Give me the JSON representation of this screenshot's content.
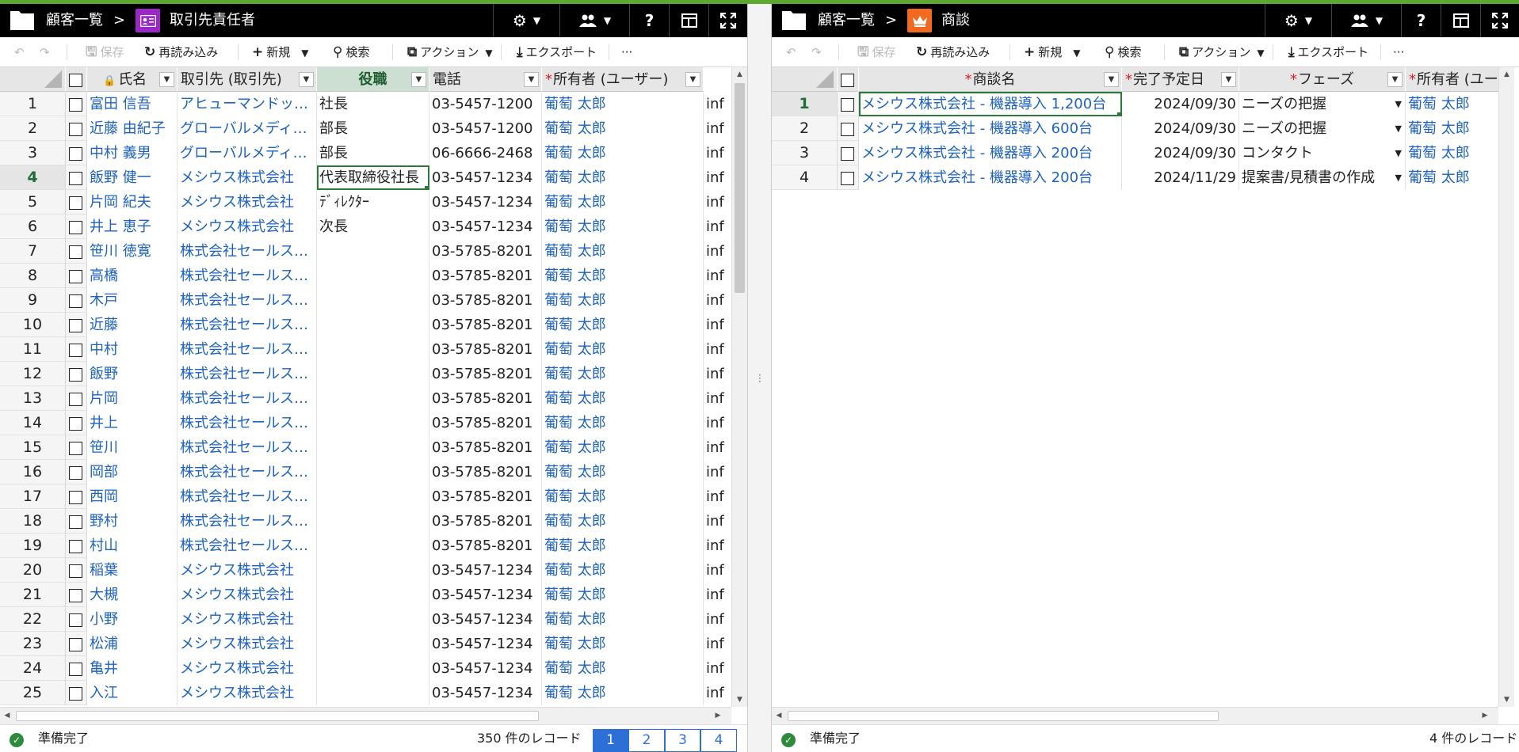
{
  "left": {
    "header": {
      "breadcrumb_root": "顧客一覧",
      "separator": ">",
      "title": "取引先責任者",
      "object_color": "#9b27c7"
    },
    "toolbar": {
      "save": "保存",
      "reload": "再読み込み",
      "new": "新規",
      "search": "検索",
      "action": "アクション",
      "export": "エクスポート",
      "more": "···"
    },
    "columns": [
      "氏名",
      "取引先 (取引先)",
      "役職",
      "電話",
      "所有者 (ユーザー)"
    ],
    "rows": [
      {
        "n": "1",
        "name": "富田 信吾",
        "account": "アヒューマンドットコ…",
        "title": "社長",
        "phone": "03-5457-1200",
        "owner": "葡萄 太郎",
        "extra": "inf"
      },
      {
        "n": "2",
        "name": "近藤 由紀子",
        "account": "グローバルメディアジ…",
        "title": "部長",
        "phone": "03-5457-1200",
        "owner": "葡萄 太郎",
        "extra": "inf"
      },
      {
        "n": "3",
        "name": "中村 義男",
        "account": "グローバルメディアジ…",
        "title": "部長",
        "phone": "06-6666-2468",
        "owner": "葡萄 太郎",
        "extra": "inf"
      },
      {
        "n": "4",
        "name": "飯野 健一",
        "account": "メシウス株式会社",
        "title": "代表取締役社長",
        "phone": "03-5457-1234",
        "owner": "葡萄 太郎",
        "extra": "inf"
      },
      {
        "n": "5",
        "name": "片岡 紀夫",
        "account": "メシウス株式会社",
        "title": "ﾃﾞｨﾚｸﾀｰ",
        "phone": "03-5457-1234",
        "owner": "葡萄 太郎",
        "extra": "inf"
      },
      {
        "n": "6",
        "name": "井上 恵子",
        "account": "メシウス株式会社",
        "title": "次長",
        "phone": "03-5457-1234",
        "owner": "葡萄 太郎",
        "extra": "inf"
      },
      {
        "n": "7",
        "name": "笹川 徳寛",
        "account": "株式会社セールス…",
        "title": "",
        "phone": "03-5785-8201",
        "owner": "葡萄 太郎",
        "extra": "inf"
      },
      {
        "n": "8",
        "name": "高橋",
        "account": "株式会社セールス…",
        "title": "",
        "phone": "03-5785-8201",
        "owner": "葡萄 太郎",
        "extra": "inf"
      },
      {
        "n": "9",
        "name": "木戸",
        "account": "株式会社セールス…",
        "title": "",
        "phone": "03-5785-8201",
        "owner": "葡萄 太郎",
        "extra": "inf"
      },
      {
        "n": "10",
        "name": "近藤",
        "account": "株式会社セールス…",
        "title": "",
        "phone": "03-5785-8201",
        "owner": "葡萄 太郎",
        "extra": "inf"
      },
      {
        "n": "11",
        "name": "中村",
        "account": "株式会社セールス…",
        "title": "",
        "phone": "03-5785-8201",
        "owner": "葡萄 太郎",
        "extra": "inf"
      },
      {
        "n": "12",
        "name": "飯野",
        "account": "株式会社セールス…",
        "title": "",
        "phone": "03-5785-8201",
        "owner": "葡萄 太郎",
        "extra": "inf"
      },
      {
        "n": "13",
        "name": "片岡",
        "account": "株式会社セールス…",
        "title": "",
        "phone": "03-5785-8201",
        "owner": "葡萄 太郎",
        "extra": "inf"
      },
      {
        "n": "14",
        "name": "井上",
        "account": "株式会社セールス…",
        "title": "",
        "phone": "03-5785-8201",
        "owner": "葡萄 太郎",
        "extra": "inf"
      },
      {
        "n": "15",
        "name": "笹川",
        "account": "株式会社セールス…",
        "title": "",
        "phone": "03-5785-8201",
        "owner": "葡萄 太郎",
        "extra": "inf"
      },
      {
        "n": "16",
        "name": "岡部",
        "account": "株式会社セールス…",
        "title": "",
        "phone": "03-5785-8201",
        "owner": "葡萄 太郎",
        "extra": "inf"
      },
      {
        "n": "17",
        "name": "西岡",
        "account": "株式会社セールス…",
        "title": "",
        "phone": "03-5785-8201",
        "owner": "葡萄 太郎",
        "extra": "inf"
      },
      {
        "n": "18",
        "name": "野村",
        "account": "株式会社セールス…",
        "title": "",
        "phone": "03-5785-8201",
        "owner": "葡萄 太郎",
        "extra": "inf"
      },
      {
        "n": "19",
        "name": "村山",
        "account": "株式会社セールス…",
        "title": "",
        "phone": "03-5785-8201",
        "owner": "葡萄 太郎",
        "extra": "inf"
      },
      {
        "n": "20",
        "name": "稲葉",
        "account": "メシウス株式会社",
        "title": "",
        "phone": "03-5457-1234",
        "owner": "葡萄 太郎",
        "extra": "inf"
      },
      {
        "n": "21",
        "name": "大槻",
        "account": "メシウス株式会社",
        "title": "",
        "phone": "03-5457-1234",
        "owner": "葡萄 太郎",
        "extra": "inf"
      },
      {
        "n": "22",
        "name": "小野",
        "account": "メシウス株式会社",
        "title": "",
        "phone": "03-5457-1234",
        "owner": "葡萄 太郎",
        "extra": "inf"
      },
      {
        "n": "23",
        "name": "松浦",
        "account": "メシウス株式会社",
        "title": "",
        "phone": "03-5457-1234",
        "owner": "葡萄 太郎",
        "extra": "inf"
      },
      {
        "n": "24",
        "name": "亀井",
        "account": "メシウス株式会社",
        "title": "",
        "phone": "03-5457-1234",
        "owner": "葡萄 太郎",
        "extra": "inf"
      },
      {
        "n": "25",
        "name": "入江",
        "account": "メシウス株式会社",
        "title": "",
        "phone": "03-5457-1234",
        "owner": "葡萄 太郎",
        "extra": "inf"
      }
    ],
    "status": {
      "text": "準備完了",
      "count": "350 件のレコード",
      "pages": [
        "1",
        "2",
        "3",
        "4"
      ]
    }
  },
  "right": {
    "header": {
      "breadcrumb_root": "顧客一覧",
      "separator": ">",
      "title": "商談",
      "object_color": "#f26a22"
    },
    "toolbar": {
      "save": "保存",
      "reload": "再読み込み",
      "new": "新規",
      "search": "検索",
      "action": "アクション",
      "export": "エクスポート",
      "more": "···"
    },
    "columns": [
      "商談名",
      "完了予定日",
      "フェーズ",
      "所有者 (ユー"
    ],
    "rows": [
      {
        "n": "1",
        "name": "メシウス株式会社 - 機器導入 1,200台",
        "date": "2024/09/30",
        "phase": "ニーズの把握",
        "owner": "葡萄 太郎"
      },
      {
        "n": "2",
        "name": "メシウス株式会社 - 機器導入 600台",
        "date": "2024/09/30",
        "phase": "ニーズの把握",
        "owner": "葡萄 太郎"
      },
      {
        "n": "3",
        "name": "メシウス株式会社 - 機器導入 200台",
        "date": "2024/09/30",
        "phase": "コンタクト",
        "owner": "葡萄 太郎"
      },
      {
        "n": "4",
        "name": "メシウス株式会社 - 機器導入 200台",
        "date": "2024/11/29",
        "phase": "提案書/見積書の作成",
        "owner": "葡萄 太郎"
      }
    ],
    "status": {
      "text": "準備完了",
      "count": "4 件のレコード"
    }
  },
  "colors": {
    "accent": "#5fa82f",
    "link": "#1d62c1",
    "selected_header": "#ccdfd2",
    "pager": "#2c6fd6"
  }
}
